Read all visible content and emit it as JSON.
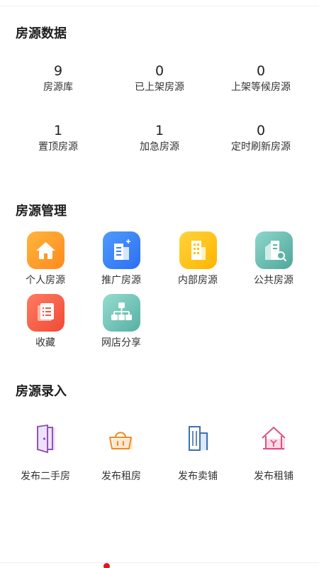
{
  "sections": {
    "data_title": "房源数据",
    "manage_title": "房源管理",
    "entry_title": "房源录入"
  },
  "stats": [
    {
      "value": "9",
      "label": "房源库"
    },
    {
      "value": "0",
      "label": "已上架房源"
    },
    {
      "value": "0",
      "label": "上架等候房源"
    },
    {
      "value": "1",
      "label": "置顶房源"
    },
    {
      "value": "1",
      "label": "加急房源"
    },
    {
      "value": "0",
      "label": "定时刷新房源"
    }
  ],
  "manage": [
    {
      "label": "个人房源",
      "icon": "house-icon"
    },
    {
      "label": "推广房源",
      "icon": "building-plus-icon"
    },
    {
      "label": "内部房源",
      "icon": "office-building-icon"
    },
    {
      "label": "公共房源",
      "icon": "building-search-icon"
    },
    {
      "label": "收藏",
      "icon": "collection-list-icon"
    },
    {
      "label": "网店分享",
      "icon": "org-tree-icon"
    }
  ],
  "entry": [
    {
      "label": "发布二手房",
      "icon": "door-icon"
    },
    {
      "label": "发布租房",
      "icon": "basket-icon"
    },
    {
      "label": "发布卖铺",
      "icon": "tall-building-icon"
    },
    {
      "label": "发布租铺",
      "icon": "home-shop-icon"
    }
  ],
  "colors": {
    "accent_red": "#e8141b",
    "orange": "#ff8a1e",
    "blue": "#2d6ff0",
    "yellow": "#ffb400",
    "teal": "#4fa79a"
  }
}
